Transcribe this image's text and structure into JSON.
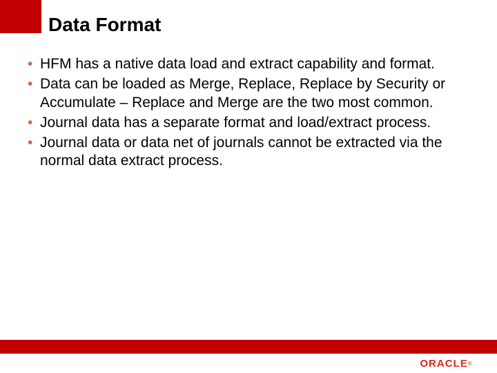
{
  "title": "Data Format",
  "bullets": [
    "HFM has a native data load and extract capability and format.",
    "Data can be loaded as Merge, Replace, Replace by Security or Accumulate – Replace and Merge are the two most common.",
    "Journal data has a separate format and load/extract process.",
    "Journal data or data net of journals cannot be extracted via the normal data extract process."
  ],
  "brand": {
    "name": "ORACLE",
    "accent_color": "#c00000"
  }
}
